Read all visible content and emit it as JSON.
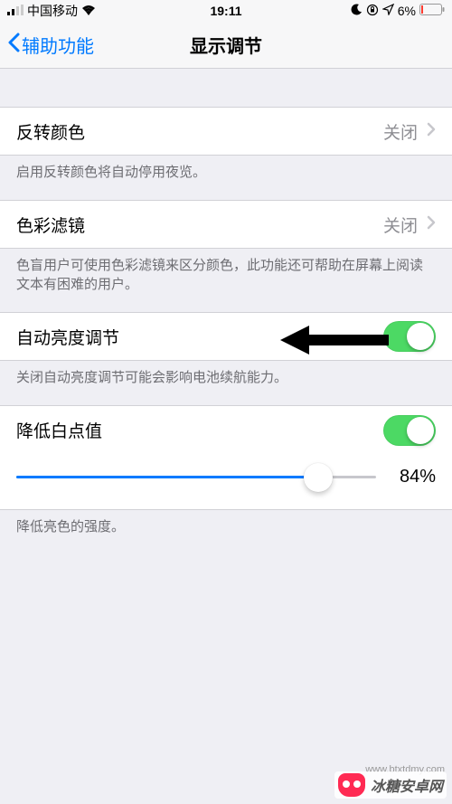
{
  "status": {
    "carrier": "中国移动",
    "time": "19:11",
    "battery_pct": "6%"
  },
  "nav": {
    "back_label": "辅助功能",
    "title": "显示调节"
  },
  "rows": {
    "invert": {
      "label": "反转颜色",
      "value": "关闭",
      "footer": "启用反转颜色将自动停用夜览。"
    },
    "filters": {
      "label": "色彩滤镜",
      "value": "关闭",
      "footer": "色盲用户可使用色彩滤镜来区分颜色，此功能还可帮助在屏幕上阅读文本有困难的用户。"
    },
    "auto_brightness": {
      "label": "自动亮度调节",
      "on": true,
      "footer": "关闭自动亮度调节可能会影响电池续航能力。"
    },
    "white_point": {
      "label": "降低白点值",
      "on": true,
      "slider_pct": 84,
      "slider_label": "84%",
      "footer": "降低亮色的强度。"
    }
  },
  "watermark": {
    "text": "冰糖安卓网",
    "url": "www.btxtdmy.com"
  }
}
